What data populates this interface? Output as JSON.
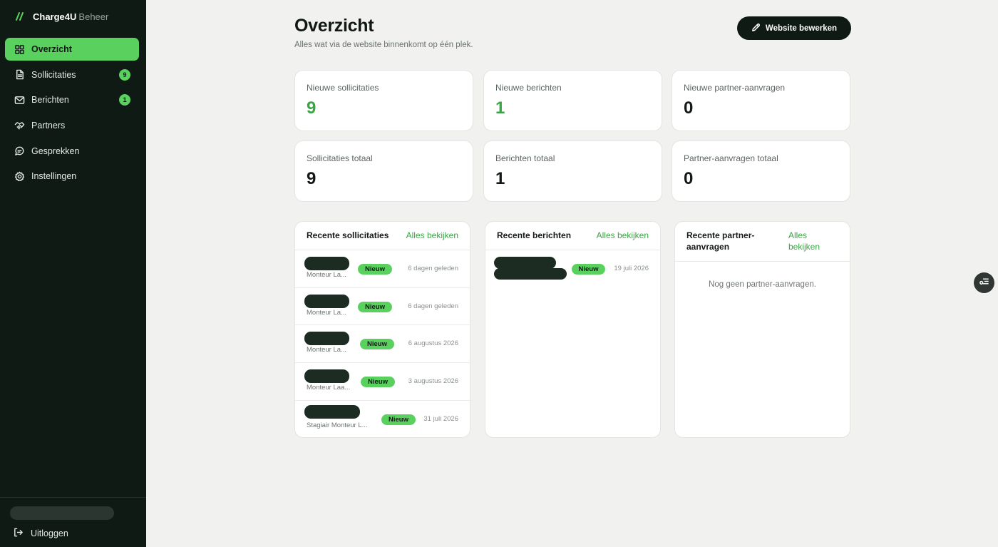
{
  "brand": {
    "name": "Charge4U",
    "suffix": "Beheer",
    "logo_icon": "double-slash-logo",
    "accent": "#5ad15f"
  },
  "sidebar": {
    "items": [
      {
        "label": "Overzicht",
        "icon": "grid-icon",
        "active": true
      },
      {
        "label": "Sollicitaties",
        "icon": "document-icon",
        "badge": "9"
      },
      {
        "label": "Berichten",
        "icon": "mail-icon",
        "badge": "1"
      },
      {
        "label": "Partners",
        "icon": "handshake-icon"
      },
      {
        "label": "Gesprekken",
        "icon": "chat-icon"
      },
      {
        "label": "Instellingen",
        "icon": "gear-icon"
      }
    ],
    "logout_label": "Uitloggen"
  },
  "header": {
    "title": "Overzicht",
    "subtitle": "Alles wat via de website binnenkomt op één plek.",
    "edit_button": "Website bewerken"
  },
  "stats": [
    {
      "label": "Nieuwe sollicitaties",
      "value": "9",
      "highlight": true
    },
    {
      "label": "Nieuwe berichten",
      "value": "1",
      "highlight": true
    },
    {
      "label": "Nieuwe partner-aanvragen",
      "value": "0",
      "highlight": false
    },
    {
      "label": "Sollicitaties totaal",
      "value": "9",
      "highlight": false
    },
    {
      "label": "Berichten totaal",
      "value": "1",
      "highlight": false
    },
    {
      "label": "Partner-aanvragen totaal",
      "value": "0",
      "highlight": false
    }
  ],
  "panels": {
    "applications": {
      "title": "Recente sollicitaties",
      "link": "Alles bekijken",
      "rows": [
        {
          "subtitle": "Monteur La...",
          "badge": "Nieuw",
          "date": "6 dagen geleden"
        },
        {
          "subtitle": "Monteur La...",
          "badge": "Nieuw",
          "date": "6 dagen geleden"
        },
        {
          "subtitle": "Monteur La...",
          "badge": "Nieuw",
          "date": "6 augustus 2026"
        },
        {
          "subtitle": "Monteur Laa...",
          "badge": "Nieuw",
          "date": "3 augustus 2026"
        },
        {
          "subtitle": "Stagiair Monteur L...",
          "badge": "Nieuw",
          "date": "31 juli 2026"
        }
      ]
    },
    "messages": {
      "title": "Recente berichten",
      "link": "Alles bekijken",
      "rows": [
        {
          "badge": "Nieuw",
          "date": "19 juli 2026"
        }
      ]
    },
    "partners": {
      "title": "Recente partner-aanvragen",
      "link": "Alles bekijken",
      "empty": "Nog geen partner-aanvragen."
    }
  },
  "floating_button": {
    "icon": "filter-list-icon"
  }
}
